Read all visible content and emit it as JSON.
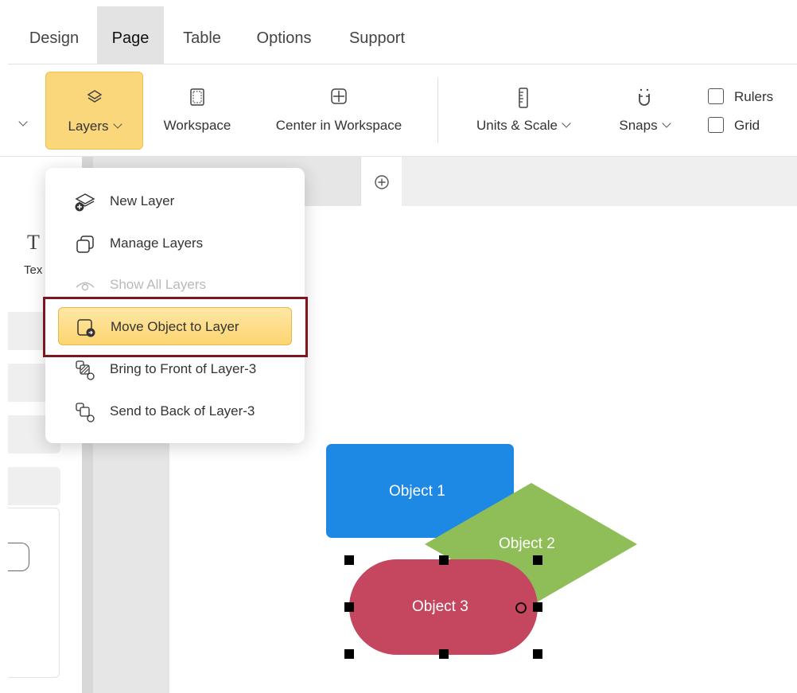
{
  "menu_tabs": [
    "Design",
    "Page",
    "Table",
    "Options",
    "Support"
  ],
  "active_tab": "Page",
  "ribbon": {
    "layers_label": "Layers",
    "workspace_label": "Workspace",
    "center_label": "Center in Workspace",
    "units_label": "Units & Scale",
    "snaps_label": "Snaps",
    "rulers_label": "Rulers",
    "grid_label": "Grid",
    "rulers_checked": false,
    "grid_checked": false
  },
  "left_panel": {
    "text_tool_icon_label": "T",
    "text_tool_label": "Tex"
  },
  "layers_menu": {
    "items": [
      {
        "label": "New Layer",
        "icon": "new-layer-icon",
        "enabled": true
      },
      {
        "label": "Manage Layers",
        "icon": "manage-layers-icon",
        "enabled": true
      },
      {
        "label": "Show All Layers",
        "icon": "eye-icon",
        "enabled": false
      },
      {
        "label": "Move Object to Layer",
        "icon": "move-to-layer-icon",
        "enabled": true,
        "highlighted": true
      },
      {
        "label": "Bring to Front of Layer-3",
        "icon": "bring-front-icon",
        "enabled": true
      },
      {
        "label": "Send to Back of Layer-3",
        "icon": "send-back-icon",
        "enabled": true
      }
    ]
  },
  "canvas": {
    "objects": [
      {
        "label": "Object 1",
        "shape": "rounded-rectangle",
        "color": "#1e88e5"
      },
      {
        "label": "Object 2",
        "shape": "diamond",
        "color": "#8fbe58"
      },
      {
        "label": "Object 3",
        "shape": "pill",
        "color": "#c4465f",
        "selected": true
      }
    ]
  },
  "colors": {
    "accent": "#fbd77b",
    "highlight_frame": "#7d1620"
  }
}
